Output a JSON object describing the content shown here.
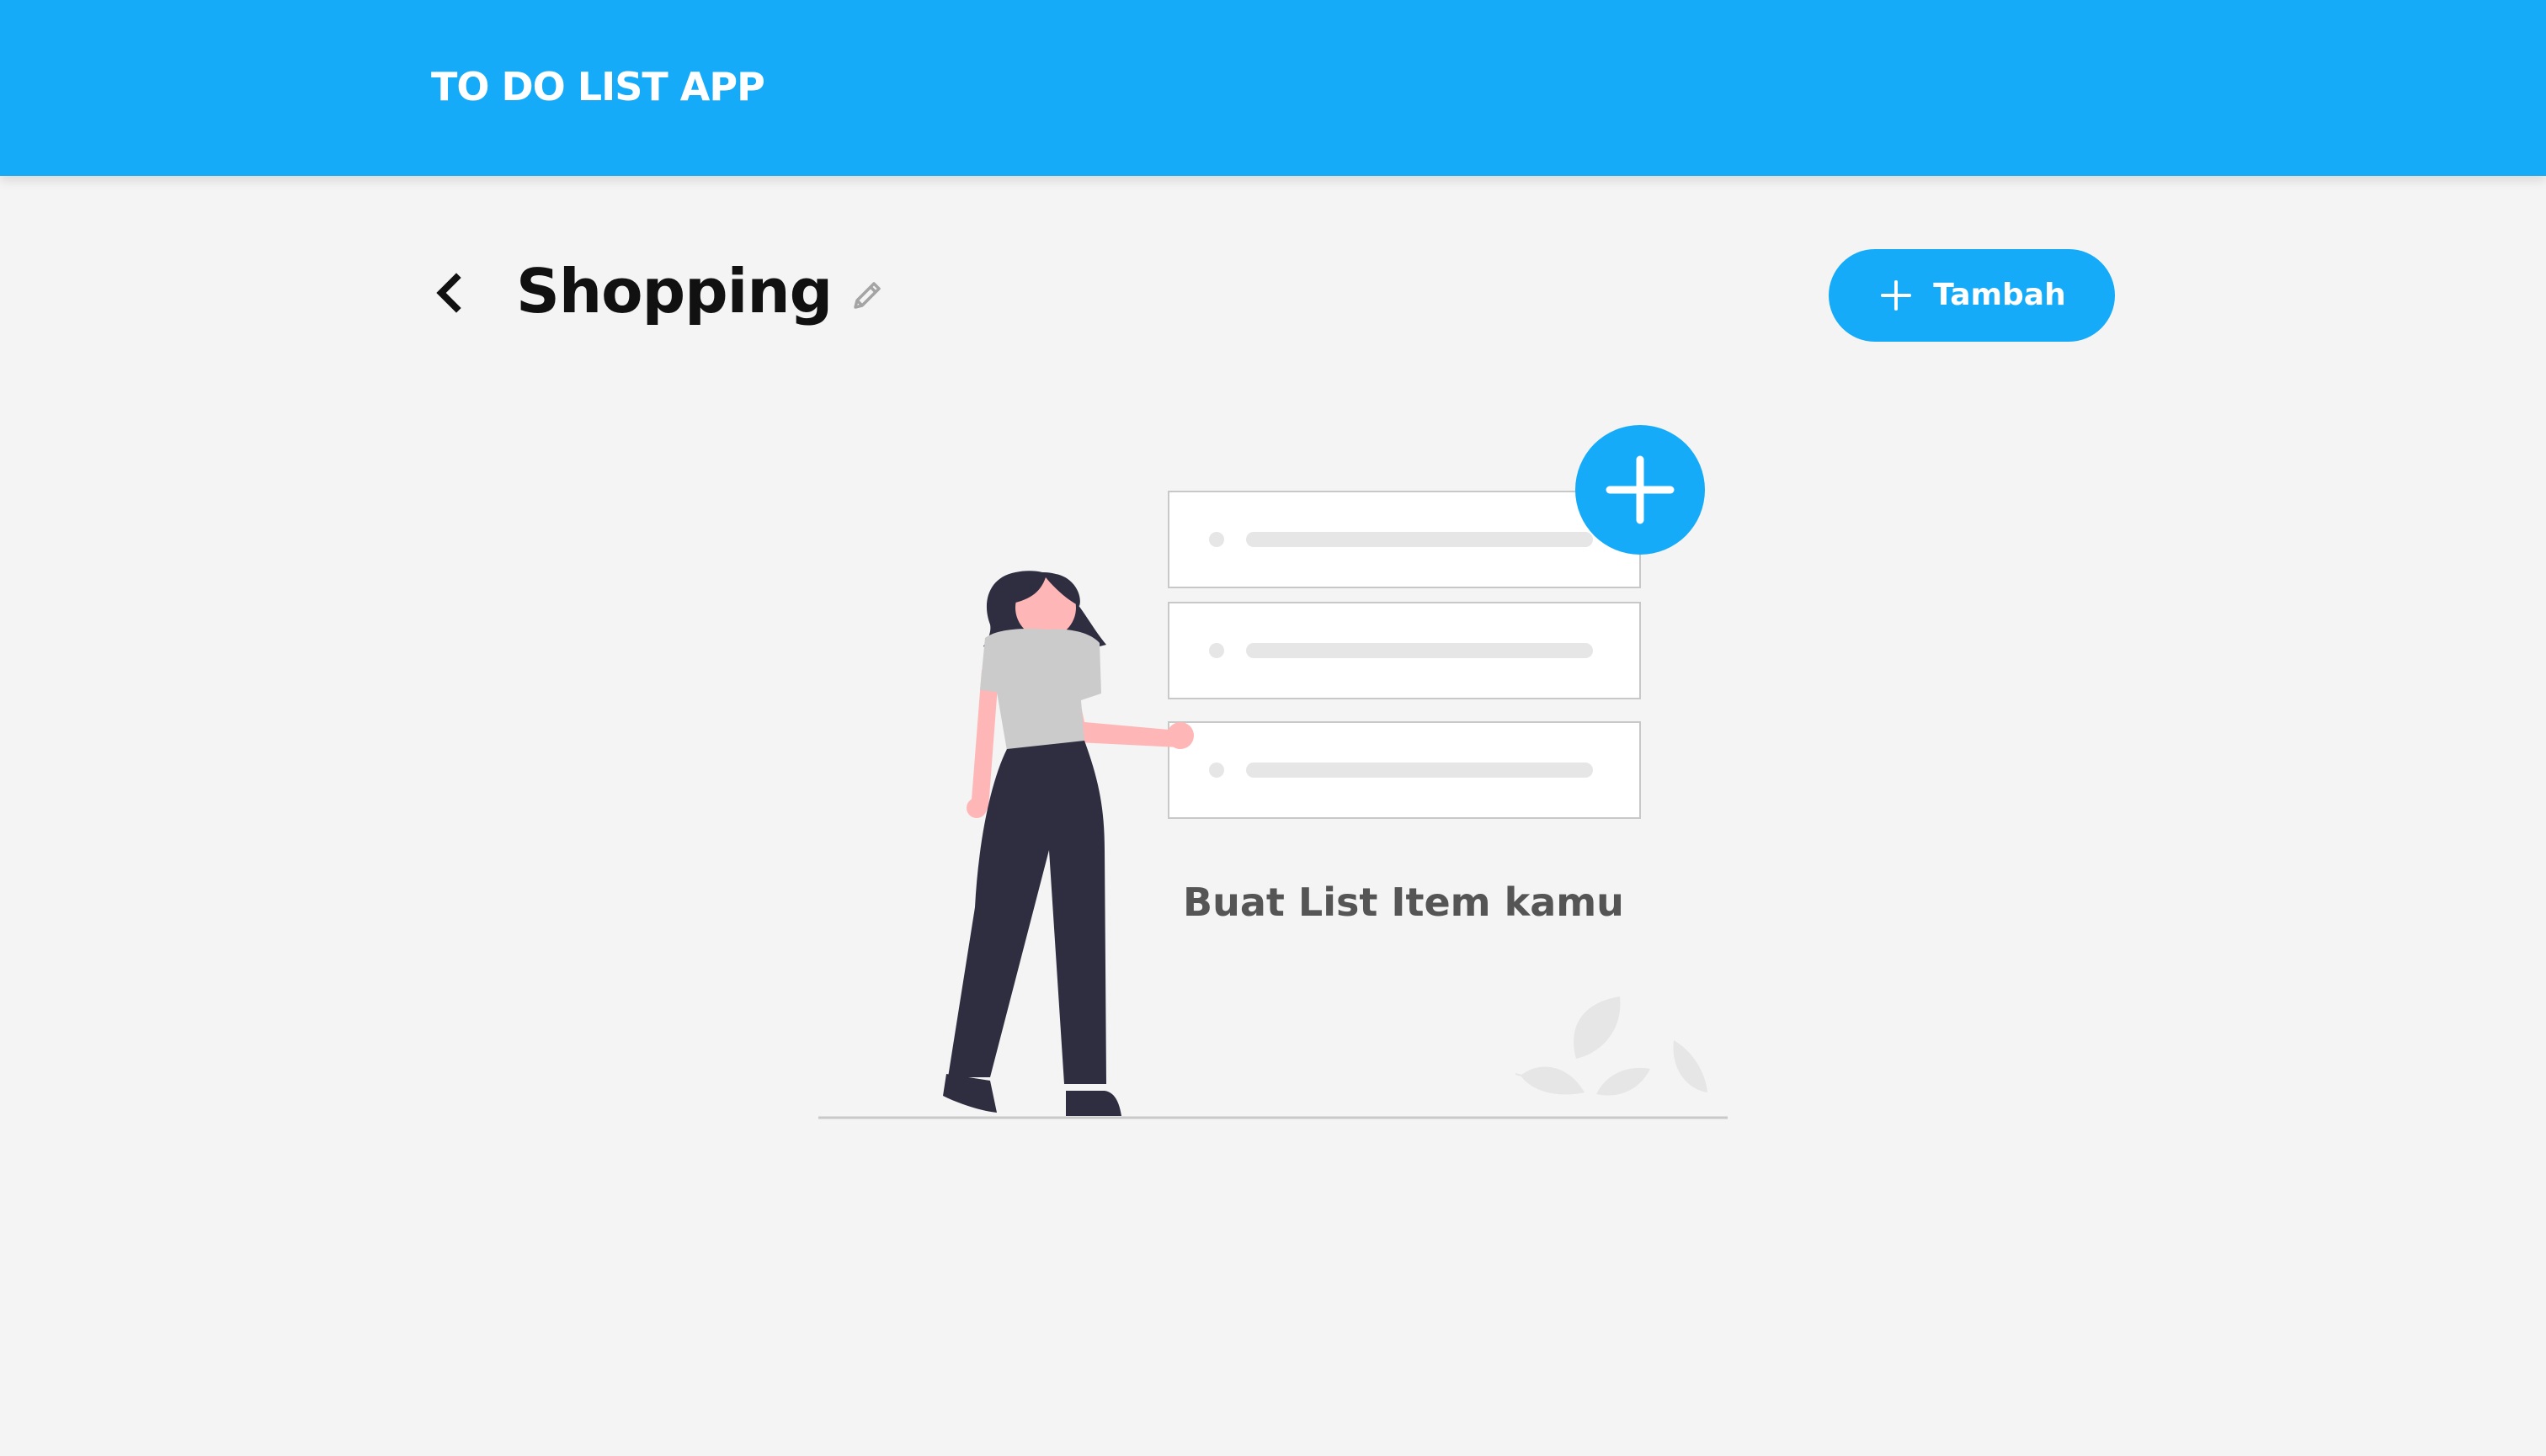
{
  "header": {
    "title": "TO DO LIST APP",
    "background_color": "#16abf8"
  },
  "activity": {
    "title": "Shopping",
    "back_icon": "chevron-left-icon",
    "edit_icon": "pencil-icon"
  },
  "toolbar": {
    "add_label": "Tambah",
    "add_icon": "plus-icon",
    "accent_color": "#16abf8"
  },
  "empty_state": {
    "message": "Buat List Item kamu",
    "illustration": "woman-with-todo-list-illustration"
  }
}
